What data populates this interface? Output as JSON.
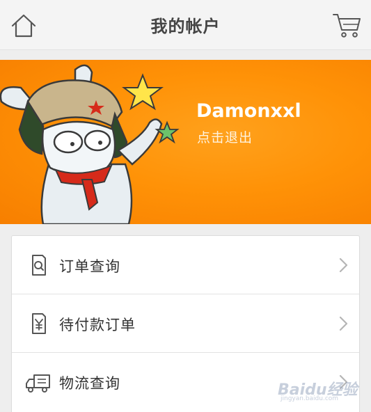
{
  "header": {
    "title": "我的帐户",
    "home_icon": "home-icon",
    "cart_icon": "cart-icon"
  },
  "profile": {
    "username": "Damonxxl",
    "logout_label": "点击退出",
    "banner_color": "#ff9207"
  },
  "menu": {
    "items": [
      {
        "label": "订单查询",
        "icon": "order-search-icon"
      },
      {
        "label": "待付款订单",
        "icon": "payment-pending-icon"
      },
      {
        "label": "物流查询",
        "icon": "delivery-truck-icon"
      }
    ]
  },
  "watermark": {
    "text": "Baidu经验",
    "sub": "jingyan.baidu.com"
  }
}
